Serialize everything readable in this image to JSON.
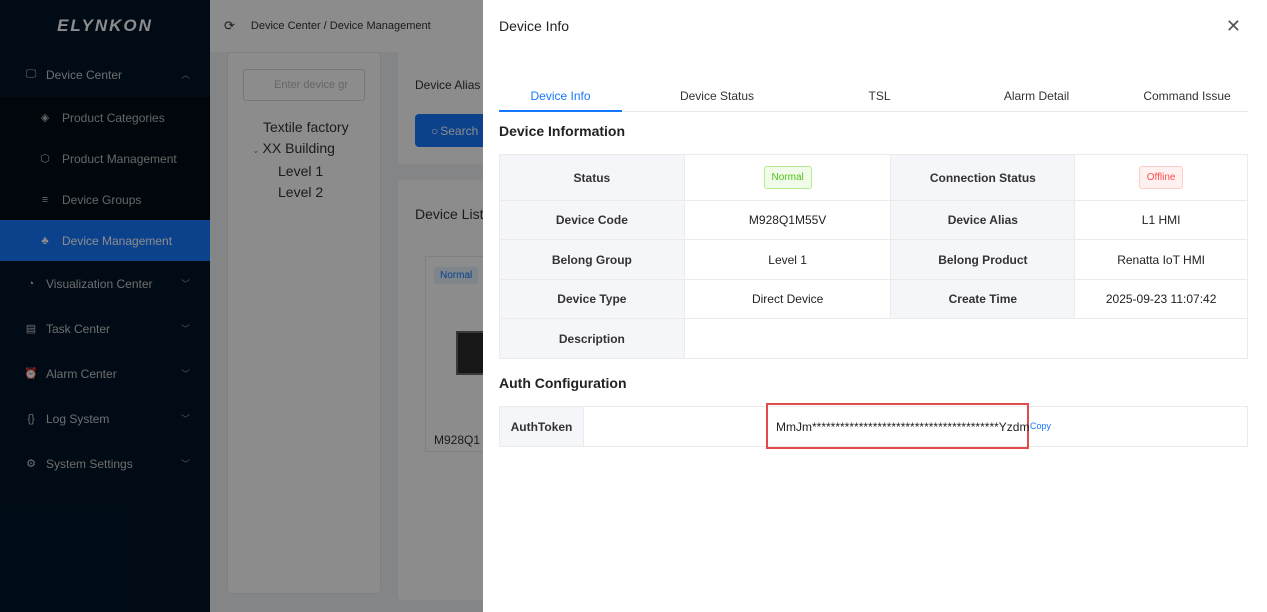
{
  "logo": "ELYNKON",
  "sidebar": {
    "items": [
      {
        "label": "Device Center",
        "icon": "monitor-icon"
      },
      {
        "label": "Visualization Center",
        "icon": "palette-icon"
      },
      {
        "label": "Task Center",
        "icon": "list-icon"
      },
      {
        "label": "Alarm Center",
        "icon": "alarm-icon"
      },
      {
        "label": "Log System",
        "icon": "log-icon"
      },
      {
        "label": "System Settings",
        "icon": "gear-icon"
      }
    ],
    "sub_items": [
      {
        "label": "Product Categories",
        "icon": "layers-icon"
      },
      {
        "label": "Product Management",
        "icon": "cube-icon"
      },
      {
        "label": "Device Groups",
        "icon": "list-icon"
      },
      {
        "label": "Device Management",
        "icon": "sitemap-icon"
      }
    ]
  },
  "breadcrumb": "Device Center / Device Management",
  "tree": {
    "search_placeholder": "Enter device gr",
    "nodes": [
      "Textile factory",
      "XX Building",
      "Level 1",
      "Level 2"
    ]
  },
  "filter": {
    "alias_label": "Device Alias",
    "search_label": "Search"
  },
  "device_list": {
    "title": "Device List",
    "card_status": "Normal",
    "card_code": "M928Q1"
  },
  "drawer": {
    "title": "Device Info",
    "tabs": [
      "Device Info",
      "Device Status",
      "TSL",
      "Alarm Detail",
      "Command Issue"
    ],
    "info_section": "Device Information",
    "auth_section": "Auth Configuration",
    "rows": {
      "status_label": "Status",
      "status_value": "Normal",
      "conn_label": "Connection Status",
      "conn_value": "Offline",
      "code_label": "Device Code",
      "code_value": "M928Q1M55V",
      "alias_label": "Device Alias",
      "alias_value": "L1 HMI",
      "group_label": "Belong Group",
      "group_value": "Level 1",
      "product_label": "Belong Product",
      "product_value": "Renatta IoT HMI",
      "type_label": "Device Type",
      "type_value": "Direct Device",
      "time_label": "Create Time",
      "time_value": "2025-09-23 11:07:42",
      "desc_label": "Description",
      "desc_value": ""
    },
    "auth": {
      "label": "AuthToken",
      "token": "MmJm****************************************Yzdm",
      "copy_label": "Copy"
    }
  },
  "colors": {
    "accent": "#1677ff",
    "highlight": "#e04b4b"
  }
}
